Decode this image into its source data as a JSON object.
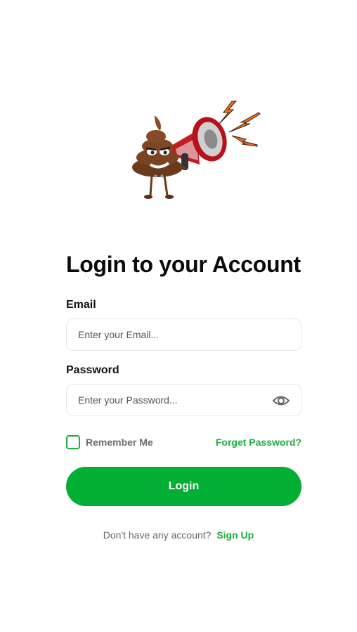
{
  "header": {
    "mascot": "poop-mascot-with-megaphone"
  },
  "login": {
    "title": "Login to your Account",
    "email": {
      "label": "Email",
      "placeholder": "Enter your Email..."
    },
    "password": {
      "label": "Password",
      "placeholder": "Enter your Password...",
      "toggle_icon": "eye-icon"
    },
    "remember_me": {
      "label": "Remember Me",
      "checked": false
    },
    "forgot_password": "Forget Password?",
    "submit_label": "Login",
    "signup_prompt": "Don't have any account?",
    "signup_link": "Sign Up"
  },
  "colors": {
    "accent": "#1aad3f",
    "button": "#03ae34",
    "text": "#111111"
  }
}
